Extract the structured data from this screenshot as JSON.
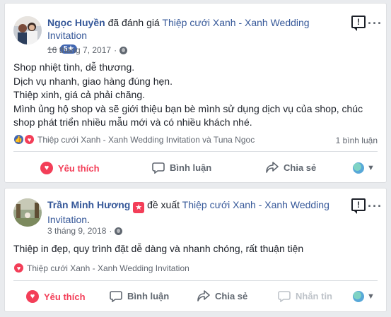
{
  "reviews": [
    {
      "author": "Ngọc Huyền",
      "verb": "đã đánh giá",
      "page": "Thiệp cưới Xanh - Xanh Wedding Invitation",
      "rating": "5★",
      "trail": "—",
      "date": "16 tháng 7, 2017",
      "lines": [
        "Shop nhiệt tình, dễ thương.",
        "Dịch vụ nhanh, giao hàng đúng hẹn.",
        "Thiệp xinh, giá cả phải chăng.",
        "Mình ủng hộ shop và sẽ giới thiệu bạn bè mình sử dụng dịch vụ của shop, chúc",
        "shop phát triển nhiều mẫu mới và có nhiều khách nhé."
      ],
      "reactions_text": "Thiệp cưới Xanh - Xanh Wedding Invitation và Tuna Ngoc",
      "comment_count": "1 bình luận",
      "actions": {
        "react": "Yêu thích",
        "comment": "Bình luận",
        "share": "Chia sẻ"
      }
    },
    {
      "author": "Trần Minh Hương",
      "verb": "đề xuất",
      "page_line1": "Thiệp cưới Xanh - Xanh Wedding",
      "page_line2": "Invitation",
      "trail": ".",
      "date": "3 tháng 9, 2018",
      "lines": [
        "Thiệp in đẹp, quy trình đặt dễ dàng và nhanh chóng, rất thuận tiện"
      ],
      "reactions_text": "Thiệp cưới Xanh - Xanh Wedding Invitation",
      "actions": {
        "react": "Yêu thích",
        "comment": "Bình luận",
        "share": "Chia sẻ",
        "message": "Nhắn tin"
      }
    }
  ],
  "icons": [
    "report-icon",
    "more-icon",
    "globe-icon",
    "heart-icon",
    "comment-icon",
    "share-icon",
    "message-icon",
    "view-as-icon",
    "chevron-down-icon"
  ],
  "colors": {
    "link": "#365899",
    "love": "#f33e58",
    "like": "#4267b2",
    "muted": "#606770"
  }
}
